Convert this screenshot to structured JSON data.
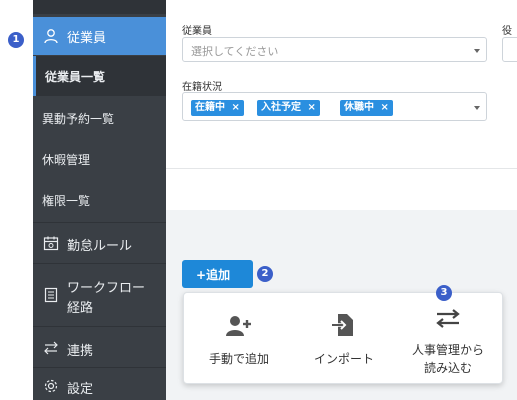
{
  "sidebar": {
    "active_label": "従業員",
    "sub_items": [
      {
        "label": "従業員一覧"
      },
      {
        "label": "異動予約一覧"
      },
      {
        "label": "休暇管理"
      },
      {
        "label": "権限一覧"
      }
    ],
    "items": [
      {
        "label": "勤怠ルール",
        "icon": "calendar-icon"
      },
      {
        "label_line1": "ワークフロー",
        "label_line2": "経路",
        "icon": "document-icon"
      },
      {
        "label": "連携",
        "icon": "exchange-icon"
      },
      {
        "label": "設定",
        "icon": "gear-icon"
      }
    ]
  },
  "form": {
    "employee_label": "従業員",
    "employee_placeholder": "選択してください",
    "role_label": "役",
    "status_label": "在籍状況",
    "status_tags": [
      "在籍中",
      "入社予定",
      "休職中"
    ],
    "tag_remove": "×"
  },
  "add_button": {
    "label": "追加",
    "icon": "plus-icon"
  },
  "dropdown": {
    "items": [
      {
        "label": "手動で追加",
        "icon": "add-user-icon"
      },
      {
        "label": "インポート",
        "icon": "import-icon"
      },
      {
        "label_line1": "人事管理から",
        "label_line2": "読み込む",
        "icon": "swap-icon"
      }
    ]
  },
  "badges": [
    "1",
    "2",
    "3"
  ],
  "colors": {
    "accent": "#4a90d9",
    "sidebar_bg": "#3a3f45",
    "tag_bg": "#2a8fe0",
    "badge_bg": "#3b5fc9"
  }
}
